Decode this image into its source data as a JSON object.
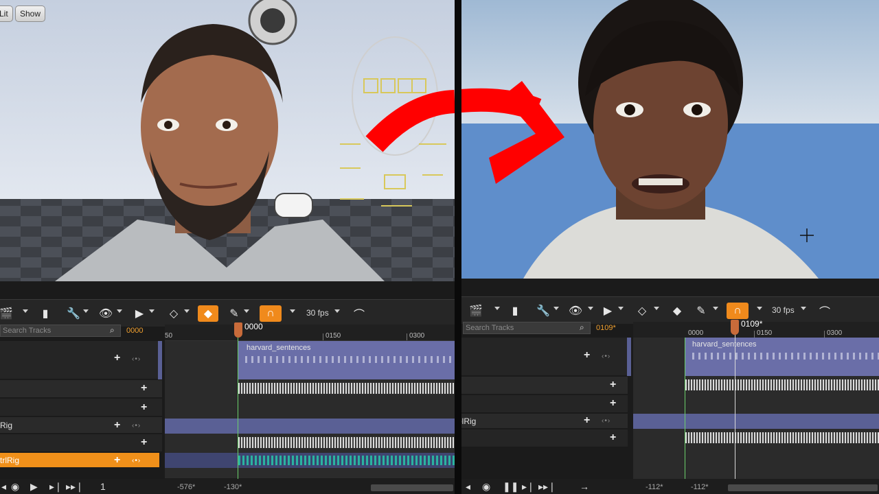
{
  "left": {
    "viewport": {
      "lit_label": "Lit",
      "show_label": "Show"
    },
    "toolbar": {
      "fps": "30 fps"
    },
    "search_placeholder": "Search Tracks",
    "frame_counter": "0000",
    "ruler": {
      "ticks": [
        "50",
        "0150",
        "0300"
      ],
      "playhead_time": "0000"
    },
    "tracks": [
      {
        "label": ""
      },
      {
        "label": ""
      },
      {
        "label": ""
      },
      {
        "label": "Rig"
      },
      {
        "label": ""
      },
      {
        "label": "trlRig"
      }
    ],
    "audio_segment": "harvard_sentences",
    "bottom": {
      "loop_label": "1",
      "range_start": "-576*",
      "range_end": "-130*"
    }
  },
  "right": {
    "toolbar": {
      "fps": "30 fps"
    },
    "search_placeholder": "Search Tracks",
    "frame_counter": "0109*",
    "ruler": {
      "ticks": [
        "0000",
        "0150",
        "0300"
      ],
      "playhead_time": "0109*"
    },
    "tracks": [
      {
        "label": ""
      },
      {
        "label": ""
      },
      {
        "label": ""
      },
      {
        "label": "olRig"
      },
      {
        "label": ""
      }
    ],
    "audio_segment": "harvard_sentences",
    "bottom": {
      "range_start": "-112*",
      "range_end": "-112*"
    }
  },
  "colors": {
    "accent_orange": "#f08a1c",
    "arrow_red": "#ff0000",
    "track_purple": "#5a6095",
    "playhead_green": "#6bd26b"
  },
  "icons": [
    "clapperboard-icon",
    "camera-icon",
    "wrench-icon",
    "eye-icon",
    "play-icon",
    "key-icon",
    "pencil-icon",
    "magnet-icon",
    "curve-icon",
    "gamepad-icon",
    "face-control-rig-icon"
  ]
}
